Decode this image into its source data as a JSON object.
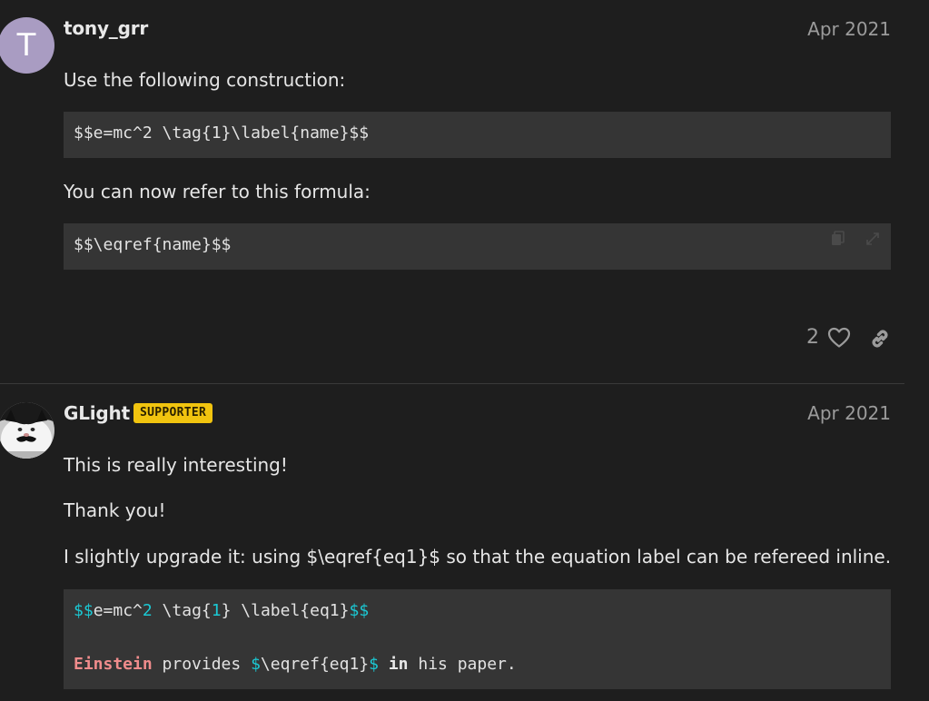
{
  "posts": [
    {
      "username": "tony_grr",
      "avatar_letter": "T",
      "avatar_color": "#a99cc2",
      "date": "Apr 2021",
      "text_1": "Use the following construction:",
      "code_1": "$$e=mc^2 \\tag{1}\\label{name}$$",
      "text_2": "You can now refer to this formula:",
      "code_2": "$$\\eqref{name}$$",
      "code_actions": [
        "copy-icon",
        "expand-icon"
      ],
      "likes": "2",
      "actions": [
        "heart-icon",
        "link-icon"
      ]
    },
    {
      "username": "GLight",
      "badge": "SUPPORTER",
      "badge_color": "#f1c40f",
      "date": "Apr 2021",
      "text_1": "This is really interesting!",
      "text_2": "Thank you!",
      "text_3": "I slightly upgrade it: using $\\eqref{eq1}$ so that the equation label can be refereed inline.",
      "code": {
        "line1": {
          "open": "$$",
          "t1": "e=mc^",
          "n2": "2",
          "t2": " \\tag{",
          "n1": "1",
          "t3": "} \\label{eq1}",
          "close": "$$"
        },
        "line2": {
          "name": "Einstein",
          "t1": " provides ",
          "d1": "$",
          "t2": "\\eqref{eq1}",
          "d2": "$",
          "t3": " ",
          "kw": "in",
          "t4": " his paper."
        }
      }
    }
  ],
  "colors": {
    "background": "#1e1e1e",
    "code_background": "#353535",
    "accent_cyan": "#1bc9d4",
    "accent_red": "#f08c8c"
  }
}
